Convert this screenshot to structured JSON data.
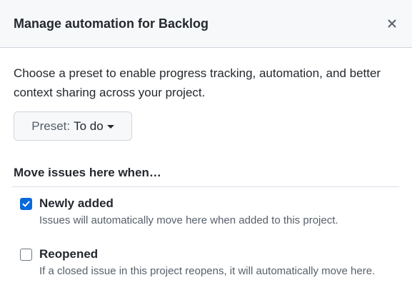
{
  "dialog": {
    "title": "Manage automation for Backlog",
    "close_icon": "close-icon"
  },
  "intro_text": "Choose a preset to enable progress tracking, automation, and better context sharing across your project.",
  "preset": {
    "prefix": "Preset:",
    "value": "To do",
    "caret_icon": "caret-down-icon"
  },
  "section": {
    "heading": "Move issues here when…",
    "options": [
      {
        "label": "Newly added",
        "description": "Issues will automatically move here when added to this project.",
        "checked": true
      },
      {
        "label": "Reopened",
        "description": "If a closed issue in this project reopens, it will automatically move here.",
        "checked": false
      }
    ]
  },
  "colors": {
    "accent": "#0969da",
    "header_bg": "#f6f8fa",
    "muted_text": "#57606a",
    "border": "#d0d7de"
  }
}
